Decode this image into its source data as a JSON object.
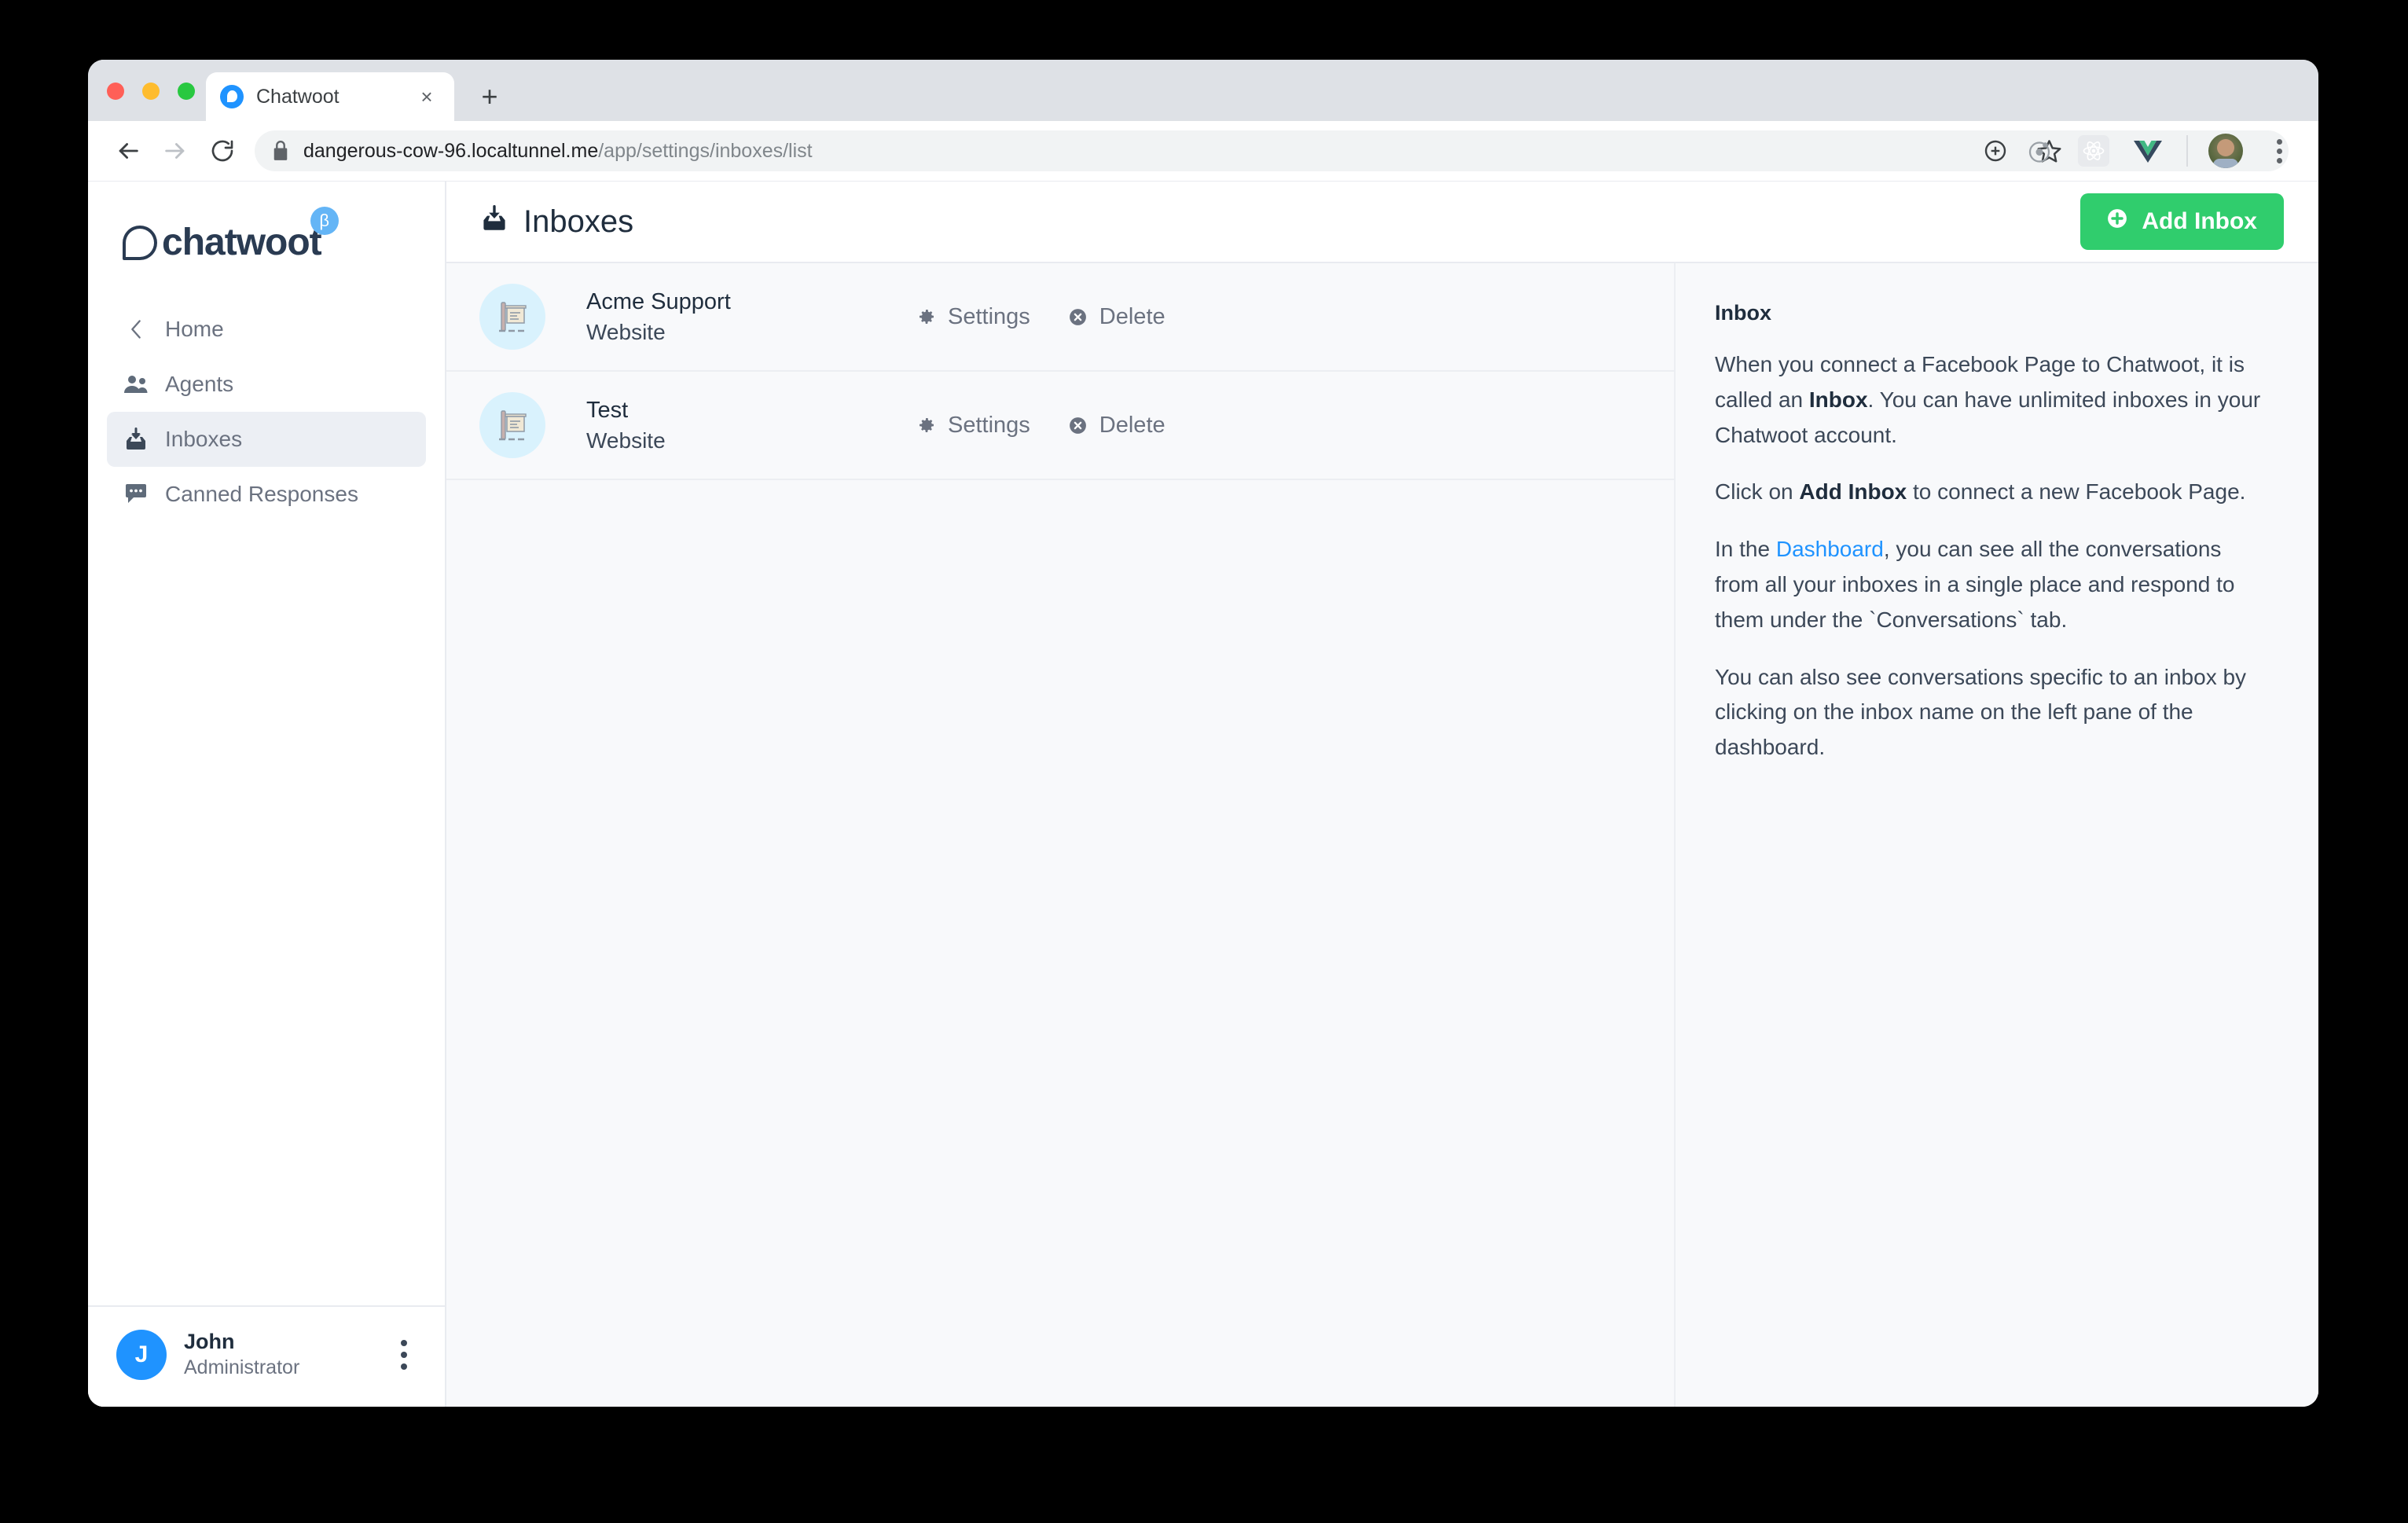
{
  "browser": {
    "tab": {
      "title": "Chatwoot",
      "favicon": "chatwoot-favicon",
      "close_label": "×"
    },
    "new_tab_label": "+",
    "url_host": "dangerous-cow-96.localtunnel.me",
    "url_path": "/app/settings/inboxes/list",
    "icons": {
      "back": "back-arrow-icon",
      "forward": "forward-arrow-icon",
      "reload": "reload-icon",
      "lock": "lock-icon",
      "add": "add-circle-icon",
      "bookmark": "star-icon",
      "ext_orbit": "orbit-extension-icon",
      "ext_react": "react-extension-icon",
      "ext_vue": "vue-extension-icon",
      "profile": "browser-profile-avatar",
      "menu": "browser-menu-icon"
    }
  },
  "sidebar": {
    "logo_text": "chatwoot",
    "beta_badge": "β",
    "items": [
      {
        "label": "Home",
        "icon": "chevron-left-icon"
      },
      {
        "label": "Agents",
        "icon": "users-icon"
      },
      {
        "label": "Inboxes",
        "icon": "inbox-icon"
      },
      {
        "label": "Canned Responses",
        "icon": "chat-bubble-icon"
      }
    ],
    "profile": {
      "initial": "J",
      "name": "John",
      "role": "Administrator",
      "menu_icon": "vertical-dots-icon"
    }
  },
  "header": {
    "title": "Inboxes",
    "title_icon": "inbox-icon",
    "add_button": {
      "label": "Add Inbox",
      "icon": "plus-circle-icon",
      "color": "#30cd6d"
    }
  },
  "inboxes": [
    {
      "name": "Acme Support",
      "channel": "Website",
      "icon": "website-signboard-icon",
      "settings_label": "Settings",
      "delete_label": "Delete"
    },
    {
      "name": "Test",
      "channel": "Website",
      "icon": "website-signboard-icon",
      "settings_label": "Settings",
      "delete_label": "Delete"
    }
  ],
  "help": {
    "title": "Inbox",
    "p1_a": "When you connect a Facebook Page to Chatwoot, it is called an ",
    "p1_b": "Inbox",
    "p1_c": ". You can have unlimited inboxes in your Chatwoot account.",
    "p2_a": "Click on ",
    "p2_b": "Add Inbox",
    "p2_c": " to connect a new Facebook Page.",
    "p3_a": "In the ",
    "p3_link": "Dashboard",
    "p3_b": ", you can see all the conversations from all your inboxes in a single place and respond to them under the `Conversations` tab.",
    "p4": "You can also see conversations specific to an inbox by clicking on the inbox name on the left pane of the dashboard."
  }
}
